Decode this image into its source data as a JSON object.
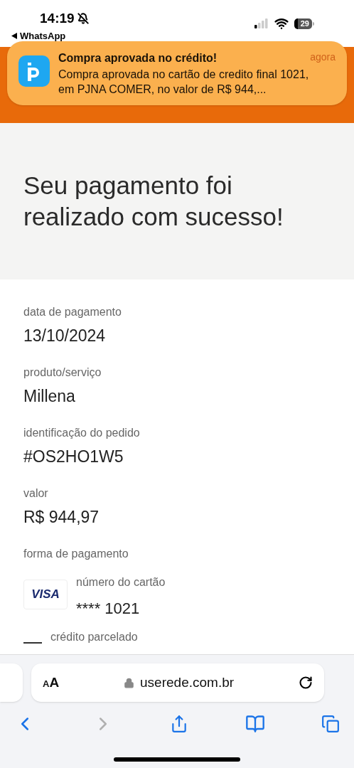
{
  "status_bar": {
    "time": "14:19",
    "back_app": "WhatsApp",
    "battery": "29"
  },
  "notification": {
    "title": "Compra aprovada no crédito!",
    "time": "agora",
    "body": "Compra aprovada no cartão de credito final 1021, em PJNA COMER, no valor de R$ 944,..."
  },
  "heading": "Seu pagamento foi realizado com sucesso!",
  "fields": [
    {
      "label": "data de pagamento",
      "value": "13/10/2024"
    },
    {
      "label": "produto/serviço",
      "value": "Millena"
    },
    {
      "label": "identificação do pedido",
      "value": "#OS2HO1W5"
    },
    {
      "label": "valor",
      "value": "R$ 944,97"
    }
  ],
  "payment": {
    "label": "forma de pagamento",
    "card_brand": "VISA",
    "card_label": "número do cartão",
    "card_number": "**** 1021",
    "installment_label": "crédito parcelado"
  },
  "browser": {
    "text_size": "AA",
    "url": "userede.com.br",
    "back_enabled": true,
    "forward_enabled": false
  }
}
